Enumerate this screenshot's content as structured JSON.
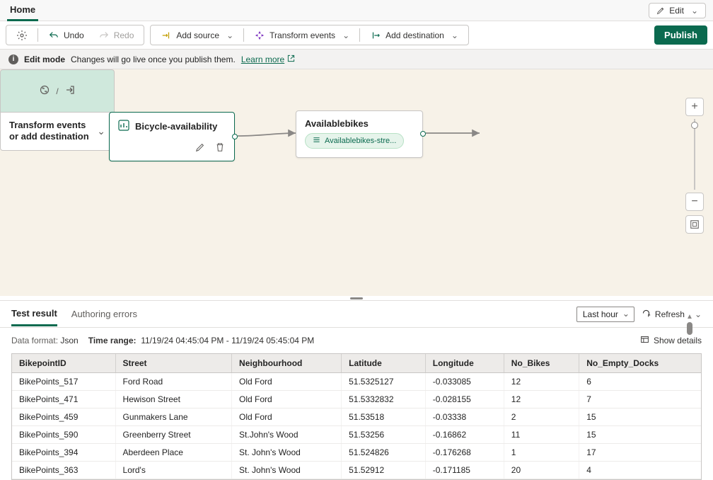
{
  "header": {
    "home_tab": "Home",
    "edit_label": "Edit"
  },
  "toolbar": {
    "undo": "Undo",
    "redo": "Redo",
    "add_source": "Add source",
    "transform_events": "Transform events",
    "add_destination": "Add destination",
    "publish": "Publish"
  },
  "info_bar": {
    "mode": "Edit mode",
    "message": "Changes will go live once you publish them.",
    "learn_more": "Learn more"
  },
  "canvas": {
    "source": {
      "title": "Bicycle-availability"
    },
    "operation": {
      "title": "Availablebikes",
      "chip": "Availablebikes-stre..."
    },
    "target": {
      "prompt": "Transform events or add destination"
    }
  },
  "results": {
    "tabs": {
      "test_result": "Test result",
      "authoring_errors": "Authoring errors"
    },
    "time_range_label": "Last hour",
    "refresh": "Refresh",
    "meta": {
      "data_format_label": "Data format:",
      "data_format_value": "Json",
      "time_range_label": "Time range:",
      "time_range_value": "11/19/24 04:45:04 PM - 11/19/24 05:45:04 PM",
      "show_details": "Show details"
    },
    "columns": [
      "BikepointID",
      "Street",
      "Neighbourhood",
      "Latitude",
      "Longitude",
      "No_Bikes",
      "No_Empty_Docks"
    ],
    "rows": [
      {
        "id": "BikePoints_517",
        "street": "Ford Road",
        "hood": "Old Ford",
        "lat": "51.5325127",
        "lon": "-0.033085",
        "bikes": "12",
        "empty": "6"
      },
      {
        "id": "BikePoints_471",
        "street": "Hewison Street",
        "hood": "Old Ford",
        "lat": "51.5332832",
        "lon": "-0.028155",
        "bikes": "12",
        "empty": "7"
      },
      {
        "id": "BikePoints_459",
        "street": "Gunmakers Lane",
        "hood": "Old Ford",
        "lat": "51.53518",
        "lon": "-0.03338",
        "bikes": "2",
        "empty": "15"
      },
      {
        "id": "BikePoints_590",
        "street": "Greenberry Street",
        "hood": "St.John's Wood",
        "lat": "51.53256",
        "lon": "-0.16862",
        "bikes": "11",
        "empty": "15"
      },
      {
        "id": "BikePoints_394",
        "street": "Aberdeen Place",
        "hood": "St. John's Wood",
        "lat": "51.524826",
        "lon": "-0.176268",
        "bikes": "1",
        "empty": "17"
      },
      {
        "id": "BikePoints_363",
        "street": "Lord's",
        "hood": "St. John's Wood",
        "lat": "51.52912",
        "lon": "-0.171185",
        "bikes": "20",
        "empty": "4"
      }
    ]
  }
}
